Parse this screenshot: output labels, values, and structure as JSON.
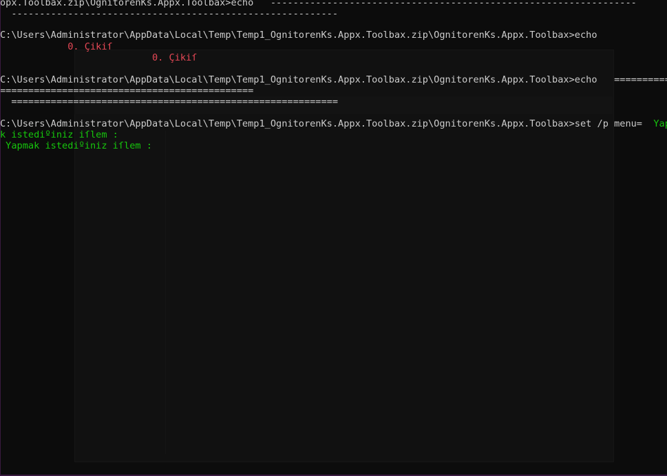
{
  "console": {
    "lines": [
      {
        "text": "opx.Toolbax.zip\\OgnitorenKs.Appx.Toolbax>echo   -----------------------------------------------------------------"
      },
      {
        "text": "  ----------------------------------------------------------"
      },
      {
        "text": "C:\\Users\\Administrator\\AppData\\Local\\Temp\\Temp1_OgnitorenKs.Appx.Toolbax.zip\\OgnitorenKs.Appx.Toolbax>echo"
      },
      {
        "text": "            0. Çikiſ"
      },
      {
        "text": "                           0. Çikiſ"
      },
      {
        "text": "C:\\Users\\Administrator\\AppData\\Local\\Temp\\Temp1_OgnitorenKs.Appx.Toolbax.zip\\OgnitorenKs.Appx.Toolbax>echo   ============"
      },
      {
        "text": "============================================="
      },
      {
        "text": "  =========================================================="
      },
      {
        "text_prompt": "C:\\Users\\Administrator\\AppData\\Local\\Temp\\Temp1_OgnitorenKs.Appx.Toolbax.zip\\OgnitorenKs.Appx.Toolbax>set /p menu=",
        "text_prompt_tail": "  Yapma"
      },
      {
        "text": "k istediºiniz iſlem :"
      },
      {
        "text": " Yapmak istediºiniz iſlem :"
      }
    ]
  },
  "colors": {
    "background": "#0c0c0c",
    "default_text": "#cccccc",
    "red_text": "#e74856",
    "green_text": "#16c60c"
  }
}
